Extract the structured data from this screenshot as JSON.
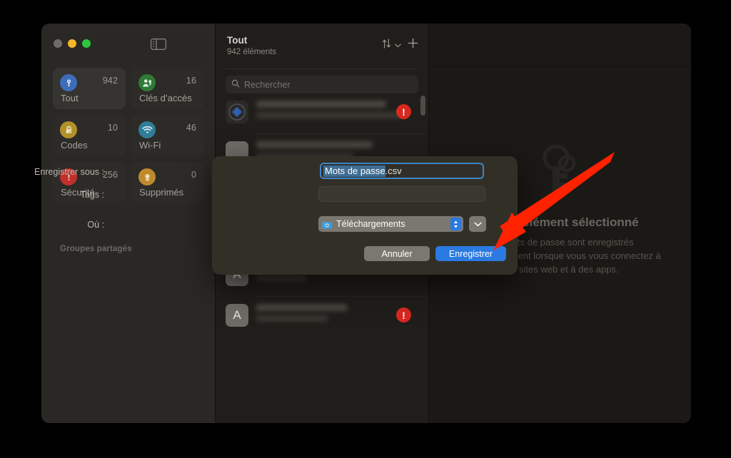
{
  "window": {
    "traffic_lights": [
      "close",
      "minimize",
      "zoom"
    ],
    "sidebar_toggle_icon": "sidebar-toggle-icon"
  },
  "sidebar": {
    "tiles": [
      {
        "label": "Tout",
        "count": "942",
        "icon": "key-icon",
        "color": "#3b6db8",
        "active": true
      },
      {
        "label": "Clés d’accès",
        "count": "16",
        "icon": "passkey-person-icon",
        "color": "#2f7a36",
        "active": false
      },
      {
        "label": "Codes",
        "count": "10",
        "icon": "lock-clock-icon",
        "color": "#b3912a",
        "active": false
      },
      {
        "label": "Wi-Fi",
        "count": "46",
        "icon": "wifi-icon",
        "color": "#2f7d97",
        "active": false
      },
      {
        "label": "Sécurité",
        "count": "256",
        "icon": "alert-icon",
        "color": "#c0302a",
        "active": false
      },
      {
        "label": "Supprimés",
        "count": "0",
        "icon": "trash-icon",
        "color": "#c08a2c",
        "active": false
      }
    ],
    "section_label": "Groupes partagés"
  },
  "list": {
    "title": "Tout",
    "subtitle": "942 éléments",
    "sort_icon": "sort-arrows-icon",
    "sort_chevron_icon": "chevron-down-icon",
    "add_icon": "plus-icon",
    "search": {
      "icon": "search-icon",
      "placeholder": "Rechercher",
      "value": ""
    },
    "rows": [
      {
        "avatar": "diamond-logo-icon",
        "avatar_bg": "#2b2926",
        "has_alert": true
      },
      {
        "avatar": "rounded-logo-icon",
        "avatar_bg": "#6f6c67",
        "has_alert": false
      },
      {
        "avatar": "adobe-logo-icon",
        "avatar_bg": "#201e1b",
        "has_alert": false
      },
      {
        "avatar": "adobe-logo-icon",
        "avatar_bg": "#201e1b",
        "has_alert": false
      },
      {
        "avatar": "letter-a-icon",
        "avatar_bg": "#6f6c67",
        "has_alert": false
      },
      {
        "avatar": "letter-a-icon",
        "avatar_bg": "#6f6c67",
        "has_alert": true
      }
    ]
  },
  "detail": {
    "watermark_icon": "lock-key-watermark-icon",
    "title": "Aucun élément sélectionné",
    "body": "Vos mots de passe sont enregistrés automatiquement lorsque vous vous connectez à des sites web et à des apps."
  },
  "save_sheet": {
    "name_label": "Enregistrer sous :",
    "name_value_selected": "Mots de passe",
    "name_value_extension": ".csv",
    "tags_label": "Tags :",
    "tags_value": "",
    "where_label": "Où :",
    "where_value": "Téléchargements",
    "where_folder_icon": "downloads-folder-icon",
    "where_stepper_icon": "up-down-stepper-icon",
    "where_expand_icon": "chevron-down-icon",
    "cancel_label": "Annuler",
    "save_label": "Enregistrer"
  },
  "annotation": {
    "arrow_color": "#ff2200",
    "arrow_target": "save-button"
  }
}
